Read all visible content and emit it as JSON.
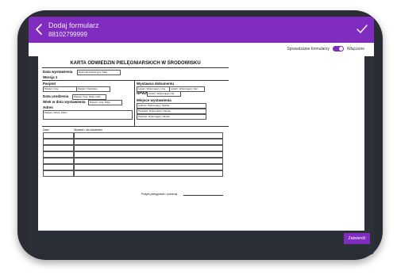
{
  "header": {
    "title": "Dodaj formularz",
    "subtitle": "88102799999"
  },
  "toolbar": {
    "toggle_label": "Sprawdzanie formularzy",
    "toggle_state": "Włączone"
  },
  "document": {
    "title": "KARTA ODWIEDZIN PIELĘGNIARSKICH W ŚRODOWISKU",
    "issue_date_label": "Data wystawienia",
    "issue_date_value": "Data administracyjna; Data",
    "version_label": "Wersja 1",
    "patient_label": "Pacjent",
    "patient_name_value": "Pacjent; Imię",
    "patient_surname_value": "Pacjent; Nazwisko",
    "birth_date_label": "Data urodzenia",
    "birth_date_value": "Pacjent; Imię; Data urodz",
    "age_label": "Wiek w dniu wystawienia",
    "age_value": "Pacjent; Imię; Wiek",
    "address_label": "Adres",
    "address_value": "Pacjent; Adres; Pełen",
    "issuer_label": "Wystawca dokumentu",
    "issuer_name_value": "Lekarz, Wykonujący; Imię",
    "issuer_surname_value": "Lekarz, Wykonujący; Naz",
    "npwz_label": "NPWZ",
    "npwz_value": "Lekarz, Wykonujący; Nu",
    "place_label": "Miejsce wystawienia",
    "place_values": [
      "Gabinet, Wykonujący; Nazwa",
      "Poradnia, Wykonujący; Nazwa",
      "Podmiot, Wykonujący; Nazwa"
    ],
    "table_col_date": "Data",
    "table_col_interview": "Wywiad i cel odwiedzin",
    "signature_label": "Podpis pielęgniarki / położnej"
  },
  "footer": {
    "submit_label": "Zatwierdź"
  },
  "colors": {
    "accent": "#7f2cbf",
    "device": "#2a2d34"
  }
}
